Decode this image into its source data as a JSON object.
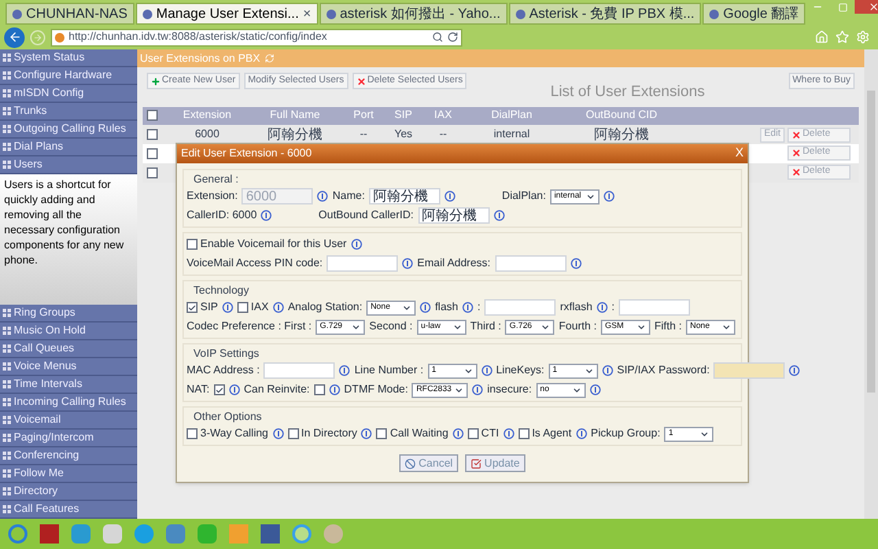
{
  "browser": {
    "tabs": [
      {
        "label": "CHUNHAN-NAS",
        "selected": false
      },
      {
        "label": "Manage User Extensi...",
        "selected": true,
        "close": "×"
      },
      {
        "label": "asterisk 如何撥出 - Yaho...",
        "selected": false
      },
      {
        "label": "Asterisk - 免費 IP PBX 模...",
        "selected": false
      },
      {
        "label": "Google 翻譯",
        "selected": false
      }
    ],
    "address": "http://chunhan.idv.tw:8088/asterisk/static/config/index"
  },
  "sidebar": {
    "items": [
      {
        "label": "System Status"
      },
      {
        "label": "Configure Hardware"
      },
      {
        "label": "mISDN Config"
      },
      {
        "label": "Trunks"
      },
      {
        "label": "Outgoing Calling Rules"
      },
      {
        "label": "Dial Plans"
      },
      {
        "label": "Users",
        "description": "Users is a shortcut for quickly adding and removing all the necessary configuration components for any new phone."
      },
      {
        "label": "Ring Groups"
      },
      {
        "label": "Music On Hold"
      },
      {
        "label": "Call Queues"
      },
      {
        "label": "Voice Menus"
      },
      {
        "label": "Time Intervals"
      },
      {
        "label": "Incoming Calling Rules"
      },
      {
        "label": "Voicemail"
      },
      {
        "label": "Paging/Intercom"
      },
      {
        "label": "Conferencing"
      },
      {
        "label": "Follow Me"
      },
      {
        "label": "Directory"
      },
      {
        "label": "Call Features"
      }
    ]
  },
  "main": {
    "title": "User Extensions on PBX",
    "toolbar": [
      {
        "label": "Create New User",
        "kind": "add"
      },
      {
        "label": "Modify Selected Users",
        "kind": "plain"
      },
      {
        "label": "Delete Selected Users",
        "kind": "delete"
      }
    ],
    "list_title": "List of User Extensions",
    "where_to_buy": "Where to Buy",
    "table": {
      "header_checked": false,
      "columns": [
        "Extension",
        "Full Name",
        "Port",
        "SIP",
        "IAX",
        "DialPlan",
        "OutBound CID"
      ],
      "rows": [
        {
          "checked": false,
          "cells": [
            "6000",
            "阿翰分機",
            "--",
            "Yes",
            "--",
            "internal",
            "阿翰分機"
          ],
          "edit": "Edit",
          "delete": "Delete"
        },
        {
          "checked": false,
          "delete": "Delete"
        },
        {
          "checked": false,
          "delete": "Delete"
        }
      ]
    }
  },
  "dialog": {
    "title": "Edit User Extension - 6000",
    "close": "X",
    "sections": [
      {
        "legend": "General :",
        "lines": [
          {
            "items": [
              {
                "kind": "text",
                "text": "Extension:"
              },
              {
                "kind": "input",
                "value": "6000",
                "disabled": true
              },
              {
                "kind": "info"
              },
              {
                "kind": "text",
                "text": "Name:"
              },
              {
                "kind": "input",
                "value": "阿翰分機",
                "disabled": false
              },
              {
                "kind": "info"
              },
              {
                "kind": "gap"
              },
              {
                "kind": "text",
                "text": "DialPlan:"
              },
              {
                "kind": "select",
                "value": "internal"
              },
              {
                "kind": "info"
              }
            ]
          },
          {
            "items": [
              {
                "kind": "text",
                "text": "CallerID: 6000"
              },
              {
                "kind": "info"
              },
              {
                "kind": "gap"
              },
              {
                "kind": "text",
                "text": "OutBound CallerID:"
              },
              {
                "kind": "input",
                "value": "阿翰分機",
                "disabled": false
              },
              {
                "kind": "info"
              }
            ]
          }
        ]
      },
      {
        "lines": [
          {
            "items": [
              {
                "kind": "checkbox",
                "label": "Enable Voicemail for this User",
                "checked": false
              },
              {
                "kind": "info"
              }
            ]
          },
          {
            "items": [
              {
                "kind": "text",
                "text": "VoiceMail Access PIN code:"
              },
              {
                "kind": "input",
                "disabled": false
              },
              {
                "kind": "info"
              },
              {
                "kind": "text",
                "text": "Email Address:"
              },
              {
                "kind": "input",
                "disabled": false
              },
              {
                "kind": "info"
              }
            ]
          }
        ]
      },
      {
        "legend": "Technology",
        "lines": [
          {
            "items": [
              {
                "kind": "checkbox",
                "label": "SIP",
                "checked": true
              },
              {
                "kind": "info"
              },
              {
                "kind": "checkbox",
                "label": "IAX",
                "checked": false
              },
              {
                "kind": "info"
              },
              {
                "kind": "text",
                "text": "Analog Station:"
              },
              {
                "kind": "select",
                "value": "None"
              },
              {
                "kind": "info"
              },
              {
                "kind": "text",
                "text": "flash"
              },
              {
                "kind": "info"
              },
              {
                "kind": "text",
                "text": ":"
              },
              {
                "kind": "input",
                "disabled": false
              },
              {
                "kind": "text",
                "text": "rxflash"
              },
              {
                "kind": "info"
              },
              {
                "kind": "text",
                "text": ":"
              },
              {
                "kind": "input",
                "disabled": false
              }
            ]
          },
          {
            "items": [
              {
                "kind": "text",
                "text": "Codec Preference : First :"
              },
              {
                "kind": "select",
                "value": "G.729"
              },
              {
                "kind": "text",
                "text": "Second :"
              },
              {
                "kind": "select",
                "value": "u-law"
              },
              {
                "kind": "text",
                "text": "Third :"
              },
              {
                "kind": "select",
                "value": "G.726"
              },
              {
                "kind": "text",
                "text": "Fourth :"
              },
              {
                "kind": "select",
                "value": "GSM"
              },
              {
                "kind": "text",
                "text": "Fifth :"
              },
              {
                "kind": "select",
                "value": "None"
              }
            ]
          }
        ]
      },
      {
        "legend": "VoIP Settings",
        "lines": [
          {
            "items": [
              {
                "kind": "text",
                "text": "MAC Address :"
              },
              {
                "kind": "input",
                "disabled": false
              },
              {
                "kind": "info"
              },
              {
                "kind": "text",
                "text": "Line Number :"
              },
              {
                "kind": "select",
                "value": "1"
              },
              {
                "kind": "info"
              },
              {
                "kind": "text",
                "text": "LineKeys:"
              },
              {
                "kind": "select",
                "value": "1"
              },
              {
                "kind": "info"
              },
              {
                "kind": "text",
                "text": "SIP/IAX Password:"
              },
              {
                "kind": "input",
                "disabled": false,
                "autofilled": true
              },
              {
                "kind": "info"
              }
            ]
          },
          {
            "items": [
              {
                "kind": "text",
                "text": "NAT:"
              },
              {
                "kind": "checkbox",
                "checked": true
              },
              {
                "kind": "info"
              },
              {
                "kind": "text",
                "text": "Can Reinvite:"
              },
              {
                "kind": "checkbox",
                "checked": false
              },
              {
                "kind": "info"
              },
              {
                "kind": "text",
                "text": "DTMF Mode:"
              },
              {
                "kind": "select",
                "value": "RFC2833"
              },
              {
                "kind": "info"
              },
              {
                "kind": "text",
                "text": "insecure:"
              },
              {
                "kind": "select",
                "value": "no"
              },
              {
                "kind": "info"
              }
            ]
          }
        ]
      },
      {
        "legend": "Other Options",
        "lines": [
          {
            "items": [
              {
                "kind": "checkbox",
                "label": "3-Way Calling",
                "checked": false
              },
              {
                "kind": "info"
              },
              {
                "kind": "checkbox",
                "label": "In Directory",
                "checked": false
              },
              {
                "kind": "info"
              },
              {
                "kind": "checkbox",
                "label": "Call Waiting",
                "checked": false
              },
              {
                "kind": "info"
              },
              {
                "kind": "checkbox",
                "label": "CTI",
                "checked": false
              },
              {
                "kind": "info"
              },
              {
                "kind": "checkbox",
                "label": "Is Agent",
                "checked": false
              },
              {
                "kind": "info"
              },
              {
                "kind": "text",
                "text": "Pickup Group:"
              },
              {
                "kind": "select",
                "value": "1"
              }
            ]
          }
        ]
      }
    ],
    "buttons": [
      {
        "label": "Cancel",
        "kind": "cancel"
      },
      {
        "label": "Update",
        "kind": "update"
      }
    ]
  }
}
